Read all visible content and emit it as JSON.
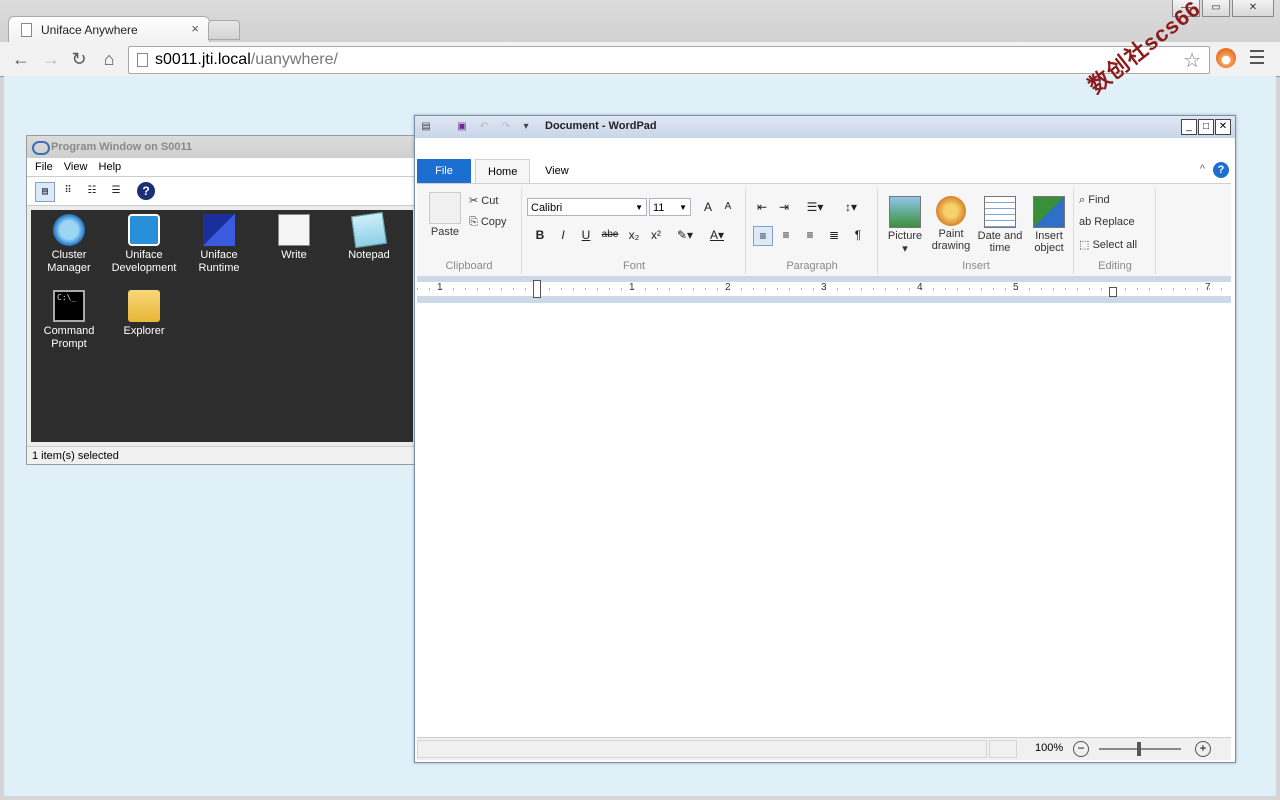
{
  "browser": {
    "tab_title": "Uniface Anywhere",
    "tab_close": "×",
    "url_host": "s0011.jti.local",
    "url_path": "/uanywhere/",
    "star": "☆",
    "nav_icons": [
      "back-arrow-icon",
      "forward-arrow-icon",
      "reload-icon",
      "home-icon"
    ]
  },
  "watermark": "数创社scs66",
  "program_window": {
    "title": "Program Window on S0011",
    "menu": [
      "File",
      "View",
      "Help"
    ],
    "icons": [
      {
        "label1": "Cluster",
        "label2": "Manager",
        "icon": "cluster-manager-icon"
      },
      {
        "label1": "Uniface",
        "label2": "Development",
        "icon": "uniface-development-icon"
      },
      {
        "label1": "Uniface",
        "label2": "Runtime",
        "icon": "uniface-runtime-icon"
      },
      {
        "label1": "Write",
        "label2": "",
        "icon": "write-icon"
      },
      {
        "label1": "Notepad",
        "label2": "",
        "icon": "notepad-icon"
      },
      {
        "label1": "Command",
        "label2": "Prompt",
        "icon": "command-prompt-icon"
      },
      {
        "label1": "Explorer",
        "label2": "",
        "icon": "explorer-icon"
      }
    ],
    "cmd_glyph": "C:\\_",
    "help": "?",
    "status": "1 item(s) selected"
  },
  "wordpad": {
    "title": "Document - WordPad",
    "tabs": {
      "file": "File",
      "home": "Home",
      "view": "View"
    },
    "help": "?",
    "clipboard": {
      "paste": "Paste",
      "cut": "Cut",
      "copy": "Copy",
      "label": "Clipboard"
    },
    "font": {
      "family": "Calibri",
      "size": "11",
      "label": "Font",
      "bold": "B",
      "italic": "I",
      "underline": "U",
      "strike": "abe",
      "sub": "x₂",
      "sup": "x²",
      "grow": "A",
      "shrink": "A",
      "color": "A"
    },
    "paragraph": {
      "label": "Paragraph"
    },
    "insert": {
      "picture": "Picture",
      "paint1": "Paint",
      "paint2": "drawing",
      "date1": "Date and",
      "date2": "time",
      "obj1": "Insert",
      "obj2": "object",
      "label": "Insert"
    },
    "editing": {
      "find": "Find",
      "replace": "Replace",
      "select_all": "Select all",
      "label": "Editing"
    },
    "ruler": [
      "1",
      "1",
      "2",
      "3",
      "4",
      "5",
      "7"
    ],
    "zoom": "100%"
  }
}
